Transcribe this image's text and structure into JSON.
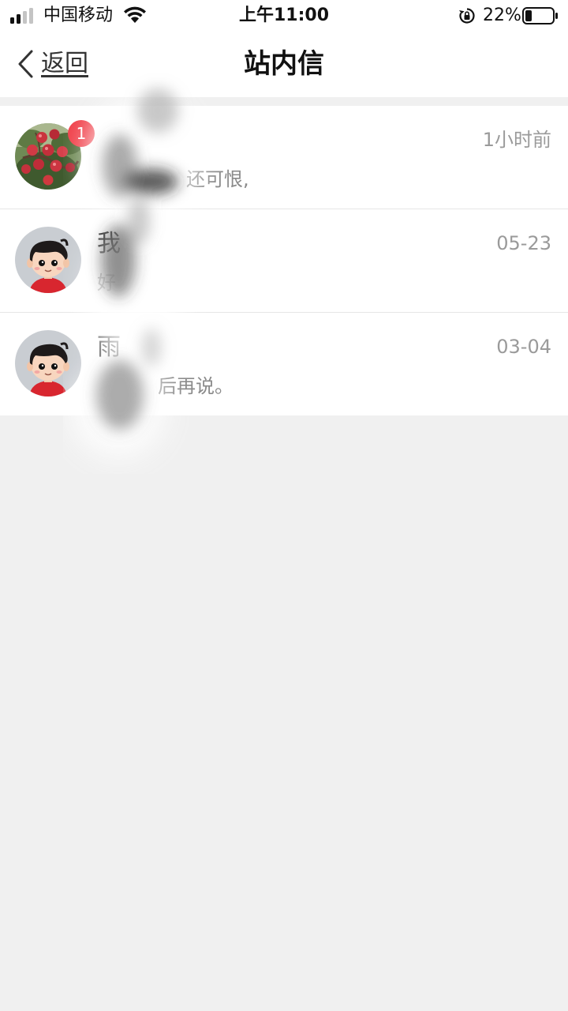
{
  "status_bar": {
    "carrier": "中国移动",
    "time": "上午11:00",
    "battery_percent": "22%",
    "icons": [
      "signal-icon",
      "wifi-icon",
      "rotation-lock-icon",
      "battery-icon"
    ]
  },
  "nav": {
    "back_label": "返回",
    "title": "站内信",
    "back_icon": "chevron-left-icon"
  },
  "messages": [
    {
      "sender": "",
      "time": "1小时前",
      "preview": "还可恨,",
      "unread": "1",
      "avatar": "apple-tree-photo"
    },
    {
      "sender": "我",
      "time": "05-23",
      "preview": "好",
      "avatar": "cartoon-boy-avatar"
    },
    {
      "sender": "雨",
      "time": "03-04",
      "preview": "后再说。",
      "avatar": "cartoon-boy-avatar"
    }
  ],
  "colors": {
    "badge": "#f0404a",
    "page_background": "#f0f0f0",
    "secondary_text": "#9a9a9a"
  }
}
